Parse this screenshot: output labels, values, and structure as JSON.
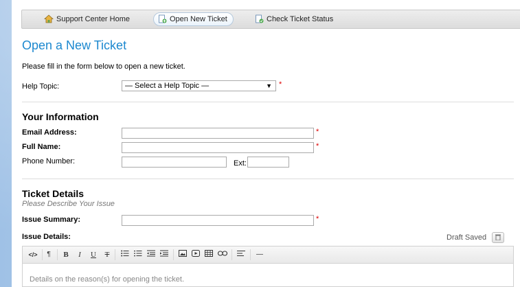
{
  "nav": {
    "home": "Support Center Home",
    "open": "Open New Ticket",
    "status": "Check Ticket Status"
  },
  "page": {
    "title": "Open a New Ticket",
    "intro": "Please fill in the form below to open a new ticket."
  },
  "help_topic": {
    "label": "Help Topic:",
    "selected": "— Select a Help Topic —",
    "required_mark": "*"
  },
  "your_info": {
    "title": "Your Information",
    "email_label": "Email Address:",
    "email_value": "",
    "name_label": "Full Name:",
    "name_value": "",
    "phone_label": "Phone Number:",
    "phone_value": "",
    "ext_label": "Ext:",
    "ext_value": "",
    "required_mark": "*"
  },
  "ticket_details": {
    "title": "Ticket Details",
    "subtitle": "Please Describe Your Issue",
    "summary_label": "Issue Summary:",
    "summary_value": "",
    "details_label": "Issue Details:",
    "draft_status": "Draft Saved",
    "placeholder": "Details on the reason(s) for opening the ticket.",
    "required_mark": "*"
  },
  "toolbar": {
    "html": "</>",
    "paragraph": "¶",
    "bold": "B",
    "italic": "I",
    "underline": "U",
    "strike": "T",
    "hr": "—"
  },
  "colors": {
    "accent": "#1c88cf",
    "required": "#dd0000"
  }
}
